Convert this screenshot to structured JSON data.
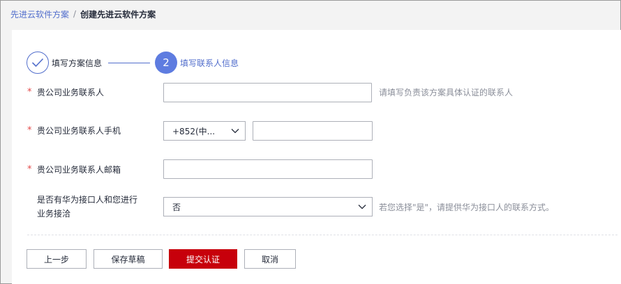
{
  "breadcrumb": {
    "parent": "先进云软件方案",
    "separator": "/",
    "current": "创建先进云软件方案"
  },
  "steps": [
    {
      "label": "填写方案信息",
      "status": "done",
      "icon": "check-icon"
    },
    {
      "number": "2",
      "label": "填写联系人信息",
      "status": "active"
    }
  ],
  "form": {
    "contact_name": {
      "label": "贵公司业务联系人",
      "required": "*",
      "value": "",
      "hint": "请填写负责该方案具体认证的联系人"
    },
    "contact_phone": {
      "label": "贵公司业务联系人手机",
      "required": "*",
      "country_code": "+852(中...",
      "value": ""
    },
    "contact_email": {
      "label": "贵公司业务联系人邮箱",
      "required": "*",
      "value": ""
    },
    "huawei_contact": {
      "label_line1": "是否有华为接口人和您进行",
      "label_line2": "业务接洽",
      "value": "否",
      "hint": "若您选择\"是\"，请提供华为接口人的联系方式。"
    }
  },
  "actions": {
    "prev": "上一步",
    "save_draft": "保存草稿",
    "submit": "提交认证",
    "cancel": "取消"
  },
  "colors": {
    "accent": "#526ecc",
    "step_active": "#5e7ce0",
    "primary_button": "#c7000b",
    "required": "#e34a4a"
  }
}
